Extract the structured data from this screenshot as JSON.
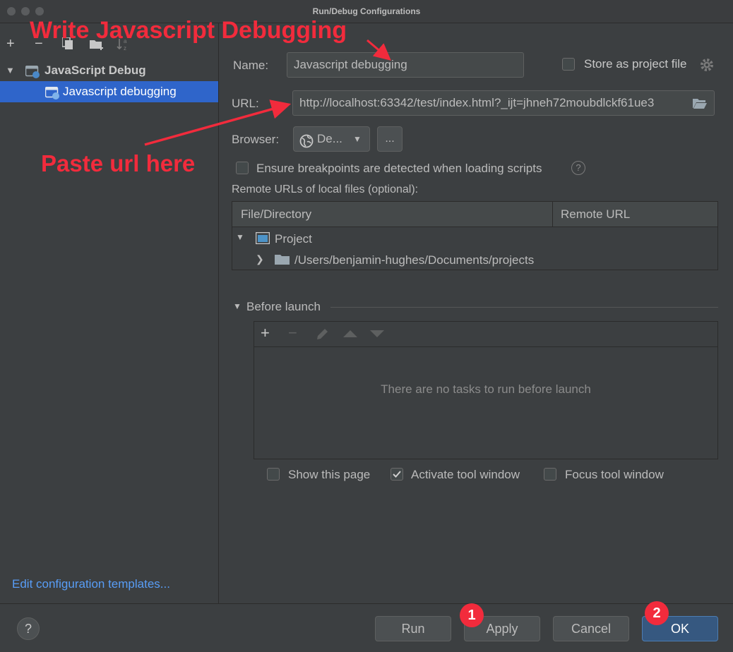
{
  "window": {
    "title": "Run/Debug Configurations"
  },
  "toolbar": {
    "add": "+",
    "remove": "−"
  },
  "tree": {
    "group": "JavaScript Debug",
    "item": "Javascript debugging"
  },
  "sidebar": {
    "templates_link": "Edit configuration templates..."
  },
  "form": {
    "name_label": "Name:",
    "name_value": "Javascript debugging",
    "store_label": "Store as project file",
    "url_label": "URL:",
    "url_value": "http://localhost:63342/test/index.html?_ijt=jhneh72moubdlckf61ue3",
    "browser_label": "Browser:",
    "browser_value": "De...",
    "browse_dots": "...",
    "ensure_label": "Ensure breakpoints are detected when loading scripts",
    "remote_label": "Remote URLs of local files (optional):"
  },
  "table": {
    "col_file": "File/Directory",
    "col_remote": "Remote URL",
    "row_project": "Project",
    "row_path": "/Users/benjamin-hughes/Documents/projects"
  },
  "before_launch": {
    "title": "Before launch",
    "empty": "There are no tasks to run before launch",
    "show_page": "Show this page",
    "activate": "Activate tool window",
    "focus": "Focus tool window",
    "activate_checked": true
  },
  "buttons": {
    "help": "?",
    "run": "Run",
    "apply": "Apply",
    "cancel": "Cancel",
    "ok": "OK"
  },
  "annotations": {
    "write": "Write Javascript Debugging",
    "paste": "Paste url here",
    "badge1": "1",
    "badge2": "2",
    "color": "#f22b3c"
  }
}
